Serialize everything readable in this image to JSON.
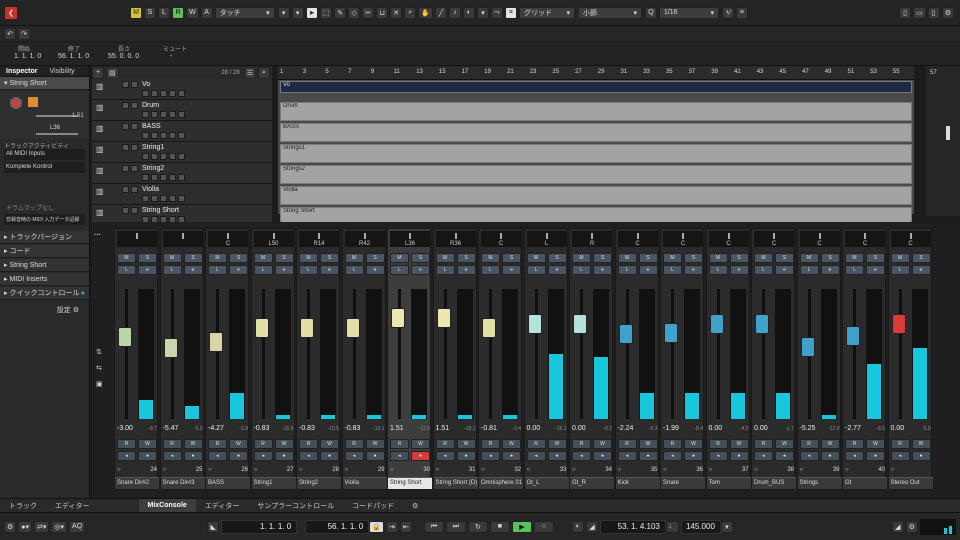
{
  "toolbar": {
    "mode_buttons": [
      "M",
      "S",
      "L",
      "R",
      "W",
      "A"
    ],
    "automation_mode": "タッチ",
    "snap_type": "グリッド",
    "grid": "小節",
    "quantize": "1/16"
  },
  "posbar": {
    "labels": [
      "開始",
      "終了",
      "長さ",
      "ミュート"
    ],
    "values": [
      "1. 1. 1. 0",
      "56. 1. 1. 0",
      "55. 0. 0. 0",
      "-"
    ]
  },
  "inspector": {
    "tabs": [
      "Inspector",
      "Visibility"
    ],
    "track_name": "String Short",
    "volume": "1.51",
    "pan": "L36",
    "routing_label": "トラックアクティビティ",
    "input": "All MIDI Inputs",
    "output": "Komplete Kontrol",
    "no_instrument": "ドラムマップなし",
    "record_note": "非録音時の MIDI 入力データ記録",
    "sections": [
      "トラックバージョン",
      "コード",
      "String Short",
      "MIDI Inserts",
      "クイックコントロール"
    ],
    "settings": "設定"
  },
  "tracklist": {
    "count": "28 / 28",
    "tracks": [
      "Vo",
      "Drum",
      "BASS",
      "String1",
      "String2",
      "Violla",
      "String Short"
    ]
  },
  "ruler": [
    "1",
    "3",
    "5",
    "7",
    "9",
    "11",
    "13",
    "15",
    "17",
    "19",
    "21",
    "23",
    "25",
    "27",
    "29",
    "31",
    "33",
    "35",
    "37",
    "39",
    "41",
    "43",
    "45",
    "47",
    "49",
    "51",
    "53",
    "55",
    "57"
  ],
  "events": [
    "Vo",
    "Drum",
    "BASS",
    "Strings1",
    "Strings2",
    "Violla",
    "String Short"
  ],
  "mixer": {
    "channels": [
      {
        "name": "Snare Dir#2",
        "num": "24",
        "pan": "",
        "gain": "-3.00",
        "peak": "-8.7",
        "level": 0.15,
        "color": "#b8d6a7"
      },
      {
        "name": "Snare Dir#3",
        "num": "25",
        "pan": "",
        "gain": "-5.47",
        "peak": "-5.0",
        "level": 0.1,
        "color": "#c9d7ab"
      },
      {
        "name": "BASS",
        "num": "26",
        "pan": "C",
        "gain": "-4.27",
        "peak": "-1.8",
        "level": 0.2,
        "color": "#d9d4a5"
      },
      {
        "name": "String1",
        "num": "27",
        "pan": "L50",
        "gain": "-0.83",
        "peak": "-15.8",
        "level": 0.03,
        "color": "#e2dfa6"
      },
      {
        "name": "String2",
        "num": "28",
        "pan": "R14",
        "gain": "-0.83",
        "peak": "-10.5",
        "level": 0.03,
        "color": "#e2dfa6"
      },
      {
        "name": "Violla",
        "num": "29",
        "pan": "R42",
        "gain": "-0.83",
        "peak": "-13.1",
        "level": 0.03,
        "color": "#e2dfa6"
      },
      {
        "name": "String Short",
        "num": "30",
        "pan": "L36",
        "gain": "1.51",
        "peak": "-12.5",
        "level": 0.03,
        "color": "#ece6b1",
        "sel": true
      },
      {
        "name": "String Short (D)",
        "num": "31",
        "pan": "R36",
        "gain": "1.51",
        "peak": "-18.1",
        "level": 0.03,
        "color": "#ece6b1"
      },
      {
        "name": "Omnisphere 01",
        "num": "32",
        "pan": "C",
        "gain": "-0.81",
        "peak": "-3.4",
        "level": 0.03,
        "color": "#e2dfa6"
      },
      {
        "name": "Gt_L",
        "num": "33",
        "pan": "L",
        "gain": "0.00",
        "peak": "-16.1",
        "level": 0.5,
        "color": "#b5e0dc"
      },
      {
        "name": "Gt_R",
        "num": "34",
        "pan": "R",
        "gain": "0.00",
        "peak": "-8.2",
        "level": 0.48,
        "color": "#b5e0dc"
      },
      {
        "name": "Kick",
        "num": "35",
        "pan": "C",
        "gain": "-2.24",
        "peak": "-5.3",
        "level": 0.2,
        "color": "#3fa2c8"
      },
      {
        "name": "Snare",
        "num": "36",
        "pan": "C",
        "gain": "-1.99",
        "peak": "-8.4",
        "level": 0.2,
        "color": "#3fa2c8"
      },
      {
        "name": "Tom",
        "num": "37",
        "pan": "C",
        "gain": "0.00",
        "peak": "-4.0",
        "level": 0.2,
        "color": "#3fa2c8"
      },
      {
        "name": "Drum_BUS",
        "num": "38",
        "pan": "C",
        "gain": "0.00",
        "peak": "-1.7",
        "level": 0.2,
        "color": "#3fa2c8"
      },
      {
        "name": "Strings",
        "num": "39",
        "pan": "C",
        "gain": "-5.25",
        "peak": "-12.0",
        "level": 0.03,
        "color": "#3fa2c8"
      },
      {
        "name": "Gt",
        "num": "40",
        "pan": "C",
        "gain": "-2.77",
        "peak": "-8.5",
        "level": 0.42,
        "color": "#3fa2c8"
      },
      {
        "name": "Stereo Out",
        "num": "",
        "pan": "C",
        "gain": "0.00",
        "peak": "0.0",
        "level": 0.55,
        "color": "#d93a3a"
      }
    ]
  },
  "bottom_tabs": [
    "トラック",
    "エディター",
    "MixConsole",
    "エディター",
    "サンプラーコントロール",
    "コードパッド"
  ],
  "transport": {
    "left_locator": "1. 1. 1. 0",
    "right_locator": "56. 1. 1. 0",
    "position": "53. 1. 4.103",
    "tempo": "145.000",
    "aq": "AQ"
  }
}
